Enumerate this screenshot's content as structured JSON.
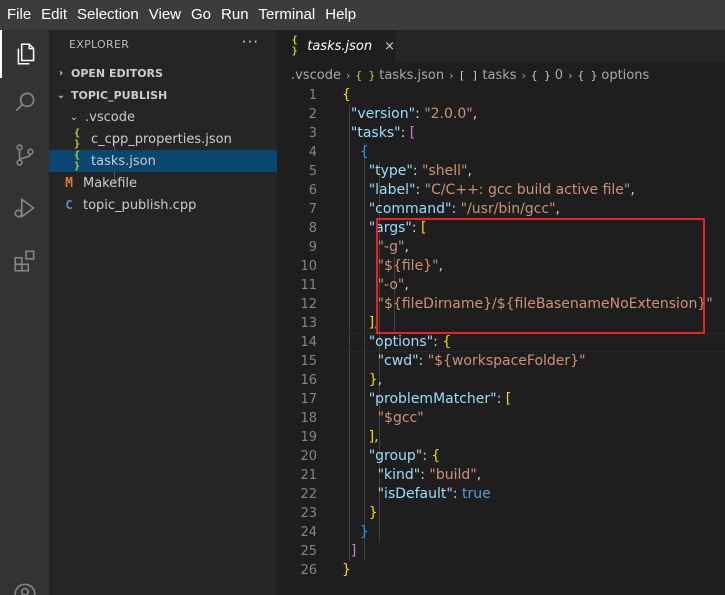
{
  "menubar": {
    "items": [
      "File",
      "Edit",
      "Selection",
      "View",
      "Go",
      "Run",
      "Terminal",
      "Help"
    ]
  },
  "activity_bar": {
    "icons": [
      "files-icon",
      "search-icon",
      "source-control-icon",
      "run-debug-icon",
      "extensions-icon"
    ]
  },
  "sidebar": {
    "title": "EXPLORER",
    "more": "···",
    "open_editors": "OPEN EDITORS",
    "project": "TOPIC_PUBLISH",
    "tree": [
      {
        "label": ".vscode",
        "type": "folder"
      },
      {
        "label": "c_cpp_properties.json",
        "type": "json"
      },
      {
        "label": "tasks.json",
        "type": "json",
        "selected": true
      },
      {
        "label": "Makefile",
        "type": "makefile"
      },
      {
        "label": "topic_publish.cpp",
        "type": "cpp"
      }
    ],
    "json_glyph": "{ }",
    "make_glyph": "M",
    "cpp_glyph": "C"
  },
  "editor": {
    "tab": {
      "label": "tasks.json",
      "close": "×",
      "glyph": "{ }"
    },
    "breadcrumb": [
      ".vscode",
      "tasks.json",
      "tasks",
      "0",
      "options"
    ],
    "breadcrumb_glyphs": [
      "{ }",
      "[ ]",
      "{ }",
      "{ }"
    ],
    "line_numbers": [
      "1",
      "2",
      "3",
      "4",
      "5",
      "6",
      "7",
      "8",
      "9",
      "10",
      "11",
      "12",
      "13",
      "14",
      "15",
      "16",
      "17",
      "18",
      "19",
      "20",
      "21",
      "22",
      "23",
      "24",
      "25",
      "26"
    ],
    "code": {
      "l1": "{",
      "l2k": "\"version\"",
      "l2s": "\"2.0.0\"",
      "l3k": "\"tasks\"",
      "l3b": "[",
      "l4": "{",
      "l5k": "\"type\"",
      "l5s": "\"shell\"",
      "l6k": "\"label\"",
      "l6s": "\"C/C++: gcc build active file\"",
      "l7k": "\"command\"",
      "l7s": "\"/usr/bin/gcc\"",
      "l8k": "\"args\"",
      "l8b": "[",
      "l9s": "\"-g\"",
      "l10s": "\"${file}\"",
      "l11s": "\"-o\"",
      "l12s": "\"${fileDirname}/${fileBasenameNoExtension}\"",
      "l13b": "]",
      "l14k": "\"options\"",
      "l14b": "{",
      "l15k": "\"cwd\"",
      "l15s": "\"${workspaceFolder}\"",
      "l16b": "}",
      "l17k": "\"problemMatcher\"",
      "l17b": "[",
      "l18s": "\"$gcc\"",
      "l19b": "]",
      "l20k": "\"group\"",
      "l20b": "{",
      "l21k": "\"kind\"",
      "l21s": "\"build\"",
      "l22k": "\"isDefault\"",
      "l22v": "true",
      "l23b": "}",
      "l24b": "}",
      "l25b": "]",
      "l26": "}"
    }
  },
  "colors": {
    "menubar": "#3c3c3c",
    "activitybar": "#333333",
    "sidebar": "#252526",
    "editor": "#1e1e1e",
    "selection": "#094771",
    "key": "#9cdcfe",
    "string": "#ce9178",
    "keyword": "#569cd6",
    "annotation": "#e8222a"
  }
}
